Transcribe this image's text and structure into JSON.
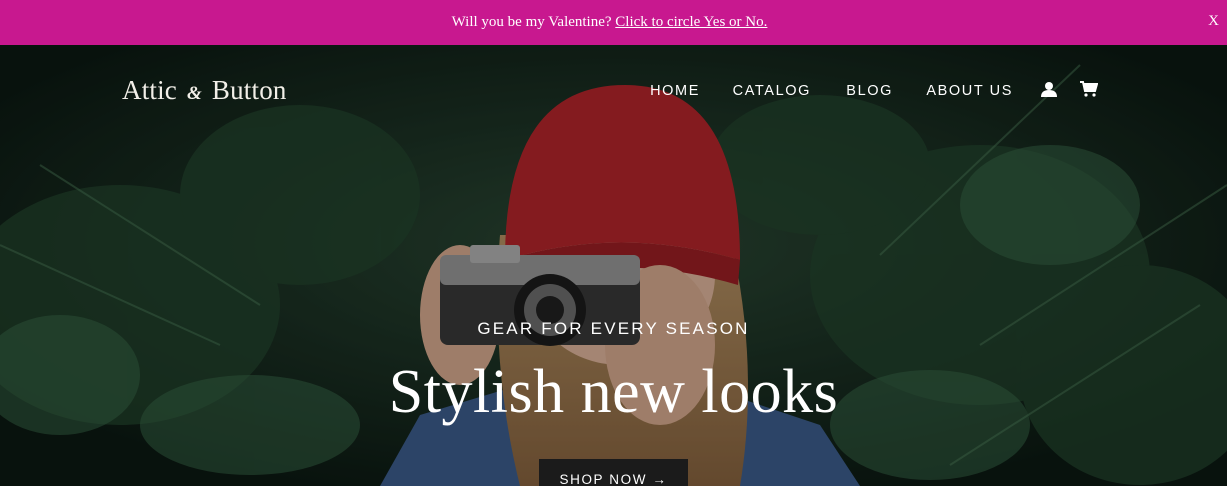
{
  "announcement": {
    "text": "Will you be my Valentine?",
    "link": "Click to circle Yes or No.",
    "close": "X"
  },
  "header": {
    "logo": {
      "part1": "Attic",
      "amp": "&",
      "part2": "Button"
    },
    "nav": [
      "HOME",
      "CATALOG",
      "BLOG",
      "ABOUT US"
    ],
    "icons": [
      "account-icon",
      "cart-icon"
    ]
  },
  "hero": {
    "eyebrow": "GEAR FOR EVERY SEASON",
    "title": "Stylish new looks",
    "button": "SHOP NOW →"
  },
  "colors": {
    "announcement_bg": "#c8188f",
    "hat": "#b8262c",
    "foliage": "#1e3b2a",
    "button_bg": "#1b1b1b"
  }
}
